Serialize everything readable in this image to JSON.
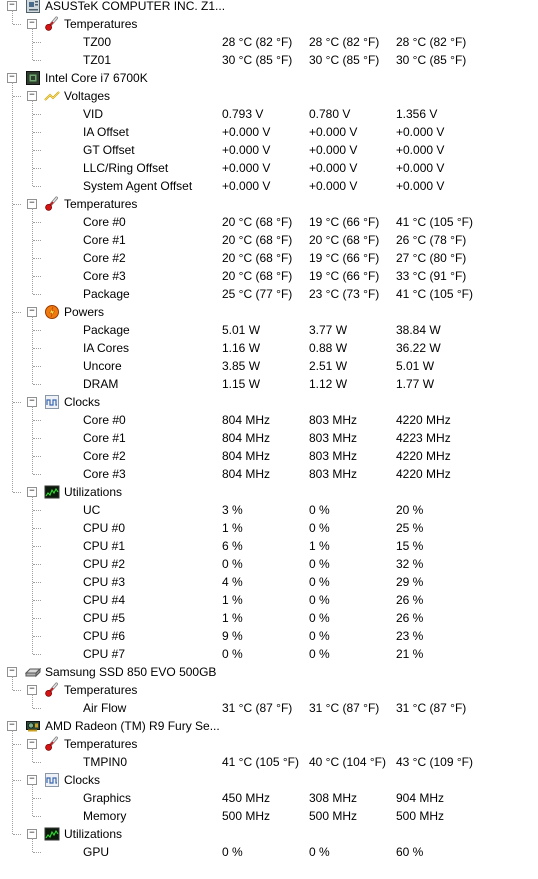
{
  "sensor_tree": [
    {
      "label": "ASUSTeK COMPUTER INC. Z1...",
      "icon": "motherboard-icon",
      "groups": [
        {
          "label": "Temperatures",
          "icon": "thermometer-icon",
          "rows": [
            {
              "label": "TZ00",
              "values": [
                "28 °C  (82 °F)",
                "28 °C  (82 °F)",
                "28 °C  (82 °F)"
              ]
            },
            {
              "label": "TZ01",
              "values": [
                "30 °C  (85 °F)",
                "30 °C  (85 °F)",
                "30 °C  (85 °F)"
              ]
            }
          ]
        }
      ]
    },
    {
      "label": "Intel Core i7 6700K",
      "icon": "cpu-chip-icon",
      "groups": [
        {
          "label": "Voltages",
          "icon": "voltage-icon",
          "rows": [
            {
              "label": "VID",
              "values": [
                "0.793 V",
                "0.780 V",
                "1.356 V"
              ]
            },
            {
              "label": "IA Offset",
              "values": [
                "+0.000 V",
                "+0.000 V",
                "+0.000 V"
              ]
            },
            {
              "label": "GT Offset",
              "values": [
                "+0.000 V",
                "+0.000 V",
                "+0.000 V"
              ]
            },
            {
              "label": "LLC/Ring Offset",
              "values": [
                "+0.000 V",
                "+0.000 V",
                "+0.000 V"
              ]
            },
            {
              "label": "System Agent Offset",
              "values": [
                "+0.000 V",
                "+0.000 V",
                "+0.000 V"
              ]
            }
          ]
        },
        {
          "label": "Temperatures",
          "icon": "thermometer-icon",
          "rows": [
            {
              "label": "Core #0",
              "values": [
                "20 °C  (68 °F)",
                "19 °C  (66 °F)",
                "41 °C  (105 °F)"
              ]
            },
            {
              "label": "Core #1",
              "values": [
                "20 °C  (68 °F)",
                "20 °C  (68 °F)",
                "26 °C  (78 °F)"
              ]
            },
            {
              "label": "Core #2",
              "values": [
                "20 °C  (68 °F)",
                "19 °C  (66 °F)",
                "27 °C  (80 °F)"
              ]
            },
            {
              "label": "Core #3",
              "values": [
                "20 °C  (68 °F)",
                "19 °C  (66 °F)",
                "33 °C  (91 °F)"
              ]
            },
            {
              "label": "Package",
              "values": [
                "25 °C  (77 °F)",
                "23 °C  (73 °F)",
                "41 °C  (105 °F)"
              ]
            }
          ]
        },
        {
          "label": "Powers",
          "icon": "power-icon",
          "rows": [
            {
              "label": "Package",
              "values": [
                "5.01 W",
                "3.77 W",
                "38.84 W"
              ]
            },
            {
              "label": "IA Cores",
              "values": [
                "1.16 W",
                "0.88 W",
                "36.22 W"
              ]
            },
            {
              "label": "Uncore",
              "values": [
                "3.85 W",
                "2.51 W",
                "5.01 W"
              ]
            },
            {
              "label": "DRAM",
              "values": [
                "1.15 W",
                "1.12 W",
                "1.77 W"
              ]
            }
          ]
        },
        {
          "label": "Clocks",
          "icon": "clock-wave-icon",
          "rows": [
            {
              "label": "Core #0",
              "values": [
                "804 MHz",
                "803 MHz",
                "4220 MHz"
              ]
            },
            {
              "label": "Core #1",
              "values": [
                "804 MHz",
                "803 MHz",
                "4223 MHz"
              ]
            },
            {
              "label": "Core #2",
              "values": [
                "804 MHz",
                "803 MHz",
                "4220 MHz"
              ]
            },
            {
              "label": "Core #3",
              "values": [
                "804 MHz",
                "803 MHz",
                "4220 MHz"
              ]
            }
          ]
        },
        {
          "label": "Utilizations",
          "icon": "utilization-graph-icon",
          "rows": [
            {
              "label": "UC",
              "values": [
                "3 %",
                "0 %",
                "20 %"
              ]
            },
            {
              "label": "CPU #0",
              "values": [
                "1 %",
                "0 %",
                "25 %"
              ]
            },
            {
              "label": "CPU #1",
              "values": [
                "6 %",
                "1 %",
                "15 %"
              ]
            },
            {
              "label": "CPU #2",
              "values": [
                "0 %",
                "0 %",
                "32 %"
              ]
            },
            {
              "label": "CPU #3",
              "values": [
                "4 %",
                "0 %",
                "29 %"
              ]
            },
            {
              "label": "CPU #4",
              "values": [
                "1 %",
                "0 %",
                "26 %"
              ]
            },
            {
              "label": "CPU #5",
              "values": [
                "1 %",
                "0 %",
                "26 %"
              ]
            },
            {
              "label": "CPU #6",
              "values": [
                "9 %",
                "0 %",
                "23 %"
              ]
            },
            {
              "label": "CPU #7",
              "values": [
                "0 %",
                "0 %",
                "21 %"
              ]
            }
          ]
        }
      ]
    },
    {
      "label": "Samsung SSD 850 EVO 500GB",
      "icon": "disk-drive-icon",
      "groups": [
        {
          "label": "Temperatures",
          "icon": "thermometer-icon",
          "rows": [
            {
              "label": "Air Flow",
              "values": [
                "31 °C  (87 °F)",
                "31 °C  (87 °F)",
                "31 °C  (87 °F)"
              ]
            }
          ]
        }
      ]
    },
    {
      "label": "AMD Radeon (TM) R9 Fury Se...",
      "icon": "gpu-card-icon",
      "groups": [
        {
          "label": "Temperatures",
          "icon": "thermometer-icon",
          "rows": [
            {
              "label": "TMPIN0",
              "values": [
                "41 °C  (105 °F)",
                "40 °C  (104 °F)",
                "43 °C  (109 °F)"
              ]
            }
          ]
        },
        {
          "label": "Clocks",
          "icon": "clock-wave-icon",
          "rows": [
            {
              "label": "Graphics",
              "values": [
                "450 MHz",
                "308 MHz",
                "904 MHz"
              ]
            },
            {
              "label": "Memory",
              "values": [
                "500 MHz",
                "500 MHz",
                "500 MHz"
              ]
            }
          ]
        },
        {
          "label": "Utilizations",
          "icon": "utilization-graph-icon",
          "rows": [
            {
              "label": "GPU",
              "values": [
                "0 %",
                "0 %",
                "60 %"
              ]
            }
          ]
        }
      ]
    }
  ],
  "expander_symbol": "−"
}
